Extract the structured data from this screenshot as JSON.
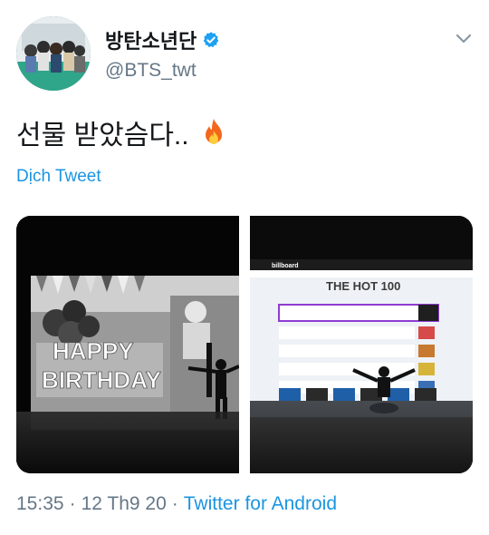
{
  "author": {
    "display_name": "방탄소년단",
    "handle": "@BTS_twt",
    "verified": true
  },
  "tweet": {
    "text": "선물 받았슴다..",
    "emoji_icon": "fire-icon",
    "translate_label": "Dịch Tweet"
  },
  "media": {
    "left_screen_text": [
      "HAPPY",
      "BIRTHDAY"
    ],
    "right_screen_title": "THE HOT 100",
    "right_brand": "billboard"
  },
  "meta": {
    "time": "15:35",
    "date": "12 Th9 20",
    "separator": "·",
    "source": "Twitter for Android"
  },
  "colors": {
    "link": "#1b95e0",
    "muted": "#657786",
    "text": "#14171a"
  }
}
